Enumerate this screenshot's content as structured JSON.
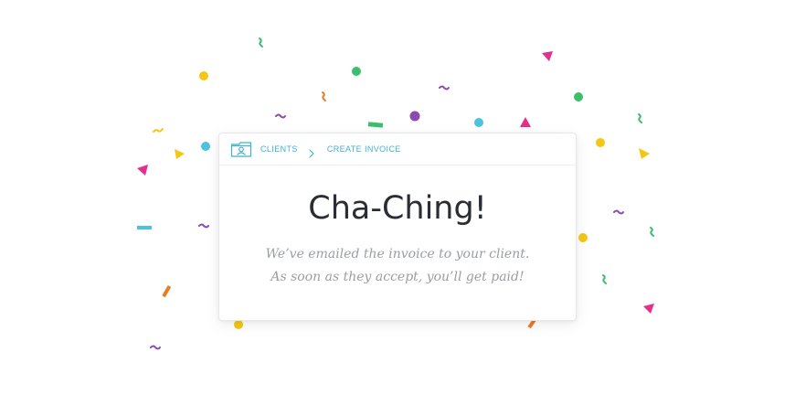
{
  "breadcrumb": {
    "icon": "client-folder-icon",
    "items": [
      {
        "label": "CLIENTS"
      },
      {
        "label": "CREATE INVOICE"
      }
    ],
    "separator_icon": "chevron-right-icon"
  },
  "card": {
    "title": "Cha-Ching!",
    "message_line1": "We’ve emailed the invoice to your client.",
    "message_line2": "As soon as they accept, you’ll get paid!"
  },
  "colors": {
    "accent": "#3fb2d0",
    "title": "#2a2d33",
    "message": "#9a9ea3",
    "confetti": [
      "#f2c813",
      "#3dbd6e",
      "#8a4bb0",
      "#e3308b",
      "#4cc3dc",
      "#ef7a24"
    ]
  }
}
